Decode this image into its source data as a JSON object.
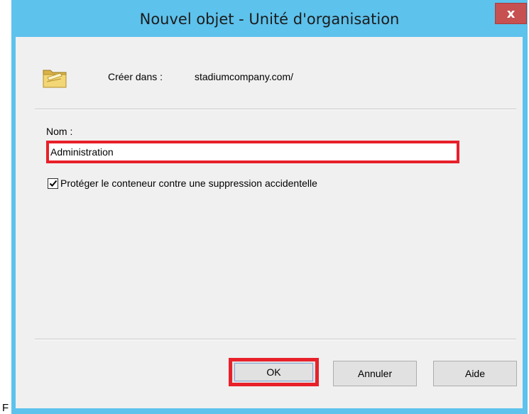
{
  "outside": {
    "stray_text": "F"
  },
  "window": {
    "title": "Nouvel objet - Unité d'organisation",
    "close_label": "x"
  },
  "header": {
    "create_in_label": "Créer dans :",
    "create_in_value": "stadiumcompany.com/",
    "icon": "ou-folder-icon"
  },
  "form": {
    "name_label": "Nom :",
    "name_value": "Administration",
    "protect_checkbox": {
      "label": "Protéger le conteneur contre une suppression accidentelle",
      "checked": true
    }
  },
  "buttons": {
    "ok": "OK",
    "cancel": "Annuler",
    "help": "Aide"
  },
  "colors": {
    "title_bar": "#5dc2ec",
    "highlight": "#e8202a",
    "close": "#c75050"
  }
}
